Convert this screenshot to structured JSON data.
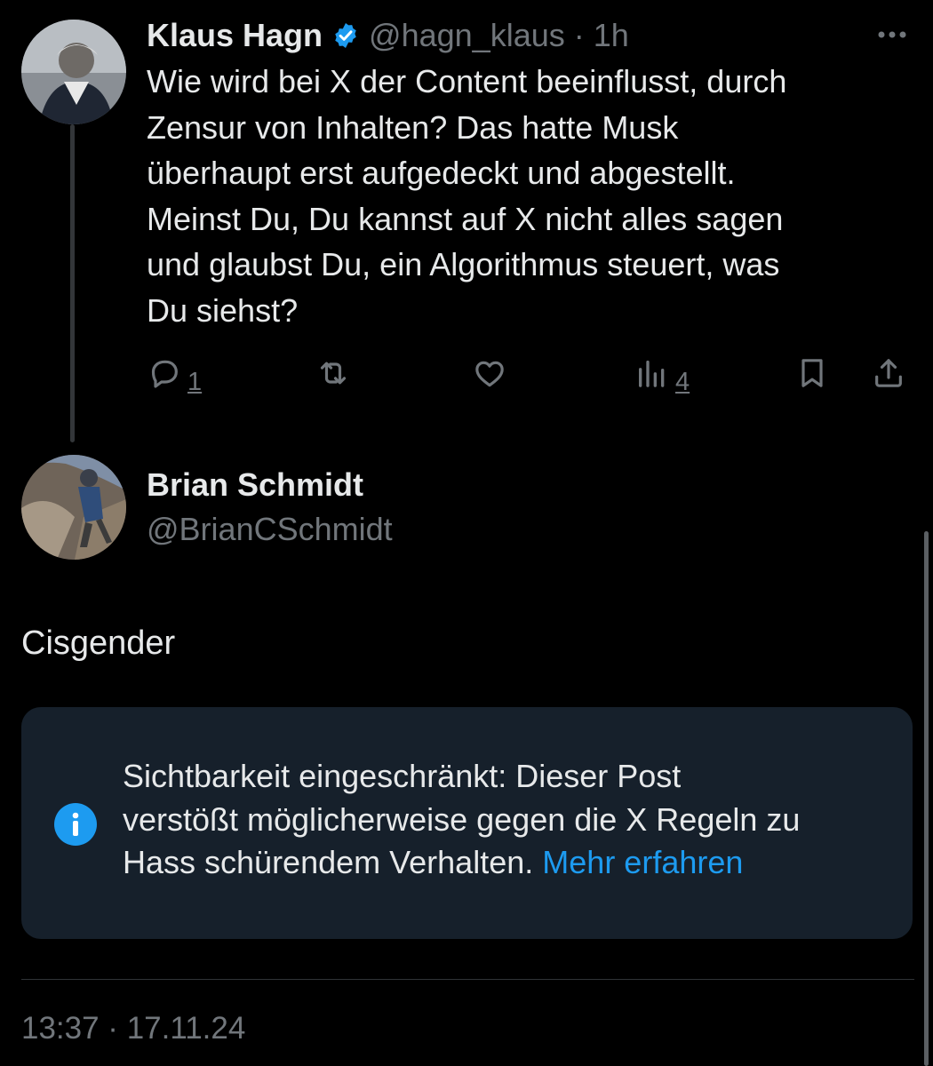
{
  "parent_post": {
    "author_name": "Klaus Hagn",
    "handle": "@hagn_klaus",
    "separator": "·",
    "time_ago": "1h",
    "verified": true,
    "text_lines": [
      "Wie wird bei X der Content beeinflusst, durch",
      "Zensur von Inhalten? Das hatte Musk",
      "überhaupt erst aufgedeckt und abgestellt.",
      "Meinst Du, Du kannst auf X nicht alles sagen",
      "und glaubst Du, ein Algorithmus steuert, was",
      "Du siehst?"
    ],
    "actions": {
      "reply_count": "1",
      "views_count": "4"
    },
    "icons": [
      "verified-badge-icon",
      "more-options-icon",
      "reply-icon",
      "repost-icon",
      "like-icon",
      "views-icon",
      "bookmark-icon",
      "share-icon"
    ]
  },
  "reply_post": {
    "author_name": "Brian Schmidt",
    "handle": "@BrianCSchmidt",
    "text": "Cisgender",
    "notice": {
      "line1": "Sichtbarkeit eingeschränkt: Dieser Post",
      "line2": "verstößt möglicherweise gegen die X Regeln zu",
      "line3_text": "Hass schürendem Verhalten.",
      "link": "Mehr erfahren",
      "icon": "info-icon"
    },
    "timestamp": "13:37 · 17.11.24"
  },
  "colors": {
    "background": "#000000",
    "text_primary": "#e7e9ea",
    "text_secondary": "#71767b",
    "accent": "#1d9bf0",
    "notice_bg": "#16202b"
  }
}
